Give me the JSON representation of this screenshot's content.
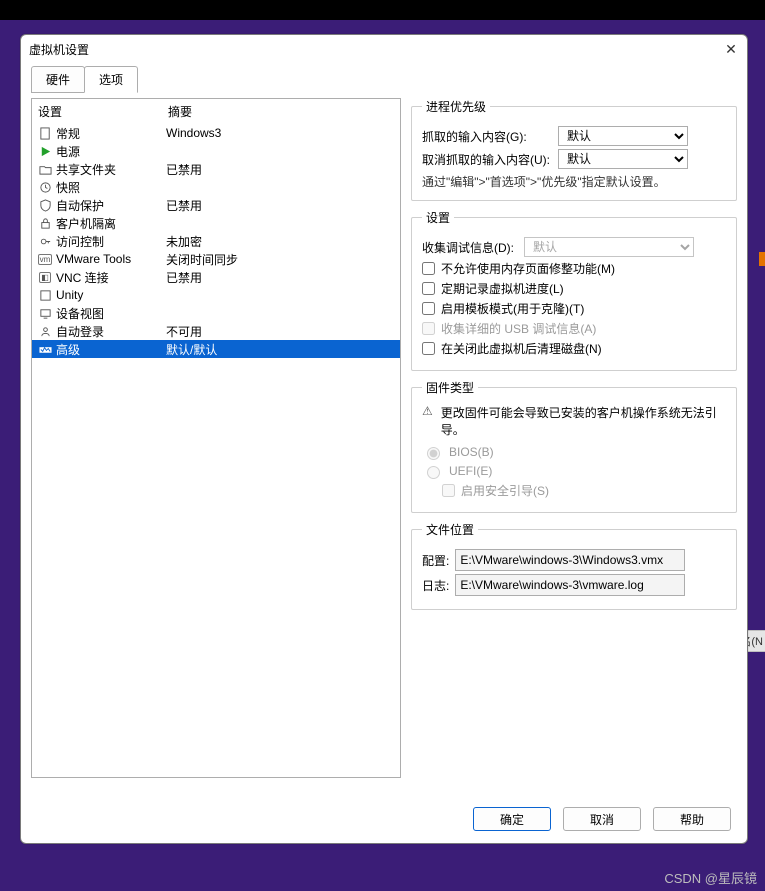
{
  "dialog": {
    "title": "虚拟机设置",
    "tabs": {
      "hardware": "硬件",
      "options": "选项"
    },
    "active_tab": "options"
  },
  "left": {
    "header": {
      "setting": "设置",
      "summary": "摘要"
    },
    "items": [
      {
        "id": "general",
        "name": "常规",
        "summary": "Windows3"
      },
      {
        "id": "power",
        "name": "电源",
        "summary": ""
      },
      {
        "id": "shared",
        "name": "共享文件夹",
        "summary": "已禁用"
      },
      {
        "id": "snapshots",
        "name": "快照",
        "summary": ""
      },
      {
        "id": "autoprot",
        "name": "自动保护",
        "summary": "已禁用"
      },
      {
        "id": "guestiso",
        "name": "客户机隔离",
        "summary": ""
      },
      {
        "id": "access",
        "name": "访问控制",
        "summary": "未加密"
      },
      {
        "id": "vmtools",
        "name": "VMware Tools",
        "summary": "关闭时间同步"
      },
      {
        "id": "vnc",
        "name": "VNC 连接",
        "summary": "已禁用"
      },
      {
        "id": "unity",
        "name": "Unity",
        "summary": ""
      },
      {
        "id": "devview",
        "name": "设备视图",
        "summary": ""
      },
      {
        "id": "autologin",
        "name": "自动登录",
        "summary": "不可用"
      },
      {
        "id": "advanced",
        "name": "高级",
        "summary": "默认/默认"
      }
    ],
    "selected": "advanced"
  },
  "priority": {
    "legend": "进程优先级",
    "grab_label": "抓取的输入内容(G):",
    "grab_value": "默认",
    "ungrab_label": "取消抓取的输入内容(U):",
    "ungrab_value": "默认",
    "note": "通过\"编辑\">\"首选项\">\"优先级\"指定默认设置。"
  },
  "settings": {
    "legend": "设置",
    "debug_label": "收集调试信息(D):",
    "debug_value": "默认",
    "chk_nomemtrim": "不允许使用内存页面修整功能(M)",
    "chk_log": "定期记录虚拟机进度(L)",
    "chk_template": "启用模板模式(用于克隆)(T)",
    "chk_usb": "收集详细的 USB 调试信息(A)",
    "chk_cleandisk": "在关闭此虚拟机后清理磁盘(N)"
  },
  "firmware": {
    "legend": "固件类型",
    "warn": "更改固件可能会导致已安装的客户机操作系统无法引导。",
    "bios": "BIOS(B)",
    "uefi": "UEFI(E)",
    "secureboot": "启用安全引导(S)"
  },
  "filelocation": {
    "legend": "文件位置",
    "config_label": "配置:",
    "config_value": "E:\\VMware\\windows-3\\Windows3.vmx",
    "log_label": "日志:",
    "log_value": "E:\\VMware\\windows-3\\vmware.log"
  },
  "buttons": {
    "ok": "确定",
    "cancel": "取消",
    "help": "帮助"
  },
  "watermark": "CSDN @星辰镜",
  "sidechip": "名(N"
}
